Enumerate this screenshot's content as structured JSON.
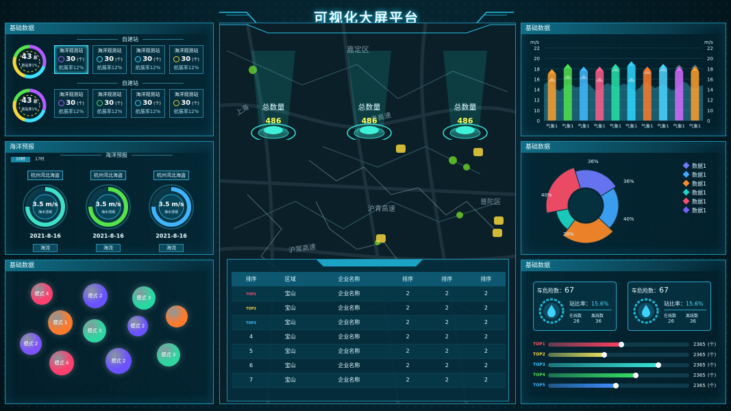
{
  "title": "可视化大屏平台",
  "left_top": {
    "head": "基础数据",
    "groups": [
      {
        "sub_title": "自建站",
        "ring_value": "43",
        "ring_unit": "总",
        "ring_caption": "航站率1%",
        "stations": [
          {
            "name": "海洋观测站",
            "count": "30",
            "unit": "(个)",
            "rate": "航展率12%",
            "color": "#b55bff",
            "active": true
          },
          {
            "name": "海洋观测站",
            "count": "30",
            "unit": "(个)",
            "rate": "航展率12%",
            "color": "#4fe0ff",
            "active": false
          },
          {
            "name": "海洋观测站",
            "count": "30",
            "unit": "(个)",
            "rate": "航展率12%",
            "color": "#3ad6ff",
            "active": false
          },
          {
            "name": "海洋观测站",
            "count": "30",
            "unit": "(个)",
            "rate": "航展率12%",
            "color": "#f4d63a",
            "active": false
          }
        ]
      },
      {
        "sub_title": "自建站",
        "ring_value": "43",
        "ring_unit": "总",
        "ring_caption": "航站率1%",
        "stations": [
          {
            "name": "海洋观测站",
            "count": "30",
            "unit": "(个)",
            "rate": "航展率12%",
            "color": "#b55bff",
            "active": false
          },
          {
            "name": "海洋观测站",
            "count": "30",
            "unit": "(个)",
            "rate": "航展率12%",
            "color": "#4fe07a",
            "active": false
          },
          {
            "name": "海洋观测站",
            "count": "30",
            "unit": "(个)",
            "rate": "航展率12%",
            "color": "#3ad6ff",
            "active": false
          },
          {
            "name": "海洋观测站",
            "count": "30",
            "unit": "(个)",
            "rate": "航展率12%",
            "color": "#f4d63a",
            "active": false
          }
        ]
      }
    ]
  },
  "left_mid": {
    "head": "海洋预报",
    "sub_title": "海洋预报",
    "tabs": [
      "10时",
      "17时"
    ],
    "gauges": [
      {
        "place": "杭州湾北海盗",
        "value": "3.5",
        "unit": "m/s",
        "caption": "海水流域",
        "date": "2021-8-16",
        "footer": "海流",
        "color": "#3ee0c8",
        "level": 0.75
      },
      {
        "place": "杭州湾北海盗",
        "value": "3.5",
        "unit": "m/s",
        "caption": "海水流域",
        "date": "2021-8-16",
        "footer": "海流",
        "color": "#55e34a",
        "level": 0.75
      },
      {
        "place": "杭州湾北海盗",
        "value": "3.5",
        "unit": "m/s",
        "caption": "海水流域",
        "date": "2021-8-16",
        "footer": "海流",
        "color": "#3fb4ff",
        "level": 0.75
      }
    ]
  },
  "left_bottom": {
    "head": "基础数据",
    "bubbles": [
      {
        "label": "模式 4",
        "color": "#ff3f6e"
      },
      {
        "label": "模式 2",
        "color": "#6a52ff"
      },
      {
        "label": "模式 3",
        "color": "#26d9a2"
      },
      {
        "label": "模式 1",
        "color": "#ff7a2a"
      },
      {
        "label": "模式 3",
        "color": "#2fd6a0"
      },
      {
        "label": "模式 2",
        "color": "#6a52ff"
      },
      {
        "label": "",
        "color": "#ff7a2a"
      },
      {
        "label": "模式 2",
        "color": "#7d53ff"
      },
      {
        "label": "模式 4",
        "color": "#ff3f6e"
      },
      {
        "label": "模式 2",
        "color": "#6a52ff"
      },
      {
        "label": "模式 3",
        "color": "#2fd6a0"
      }
    ]
  },
  "map": {
    "labels": [
      "嘉定区",
      "上海",
      "沪青高速",
      "沪常高速",
      "普陀区",
      "宝山"
    ],
    "spots": [
      {
        "label": "总数量",
        "value": "486"
      },
      {
        "label": "总数量",
        "value": "486"
      },
      {
        "label": "总数量",
        "value": "486"
      }
    ]
  },
  "table": {
    "headers": [
      "排序",
      "区域",
      "企业名称",
      "排序",
      "排序",
      "排序"
    ],
    "rows": [
      {
        "rank": "TOP1",
        "region": "宝山",
        "company": "企业名称",
        "a": "2",
        "b": "2",
        "c": "2",
        "color": "#ff4f6d"
      },
      {
        "rank": "TOP2",
        "region": "宝山",
        "company": "企业名称",
        "a": "2",
        "b": "2",
        "c": "2",
        "color": "#f7d34a"
      },
      {
        "rank": "TOP3",
        "region": "宝山",
        "company": "企业名称",
        "a": "2",
        "b": "2",
        "c": "2",
        "color": "#38c3ff"
      },
      {
        "rank": "4",
        "region": "宝山",
        "company": "企业名称",
        "a": "2",
        "b": "2",
        "c": "2",
        "color": ""
      },
      {
        "rank": "5",
        "region": "宝山",
        "company": "企业名称",
        "a": "2",
        "b": "2",
        "c": "2",
        "color": ""
      },
      {
        "rank": "6",
        "region": "宝山",
        "company": "企业名称",
        "a": "2",
        "b": "2",
        "c": "2",
        "color": ""
      },
      {
        "rank": "7",
        "region": "宝山",
        "company": "企业名称",
        "a": "2",
        "b": "2",
        "c": "2",
        "color": ""
      }
    ]
  },
  "right_top": {
    "head": "基础数据",
    "chart_data": {
      "type": "bar",
      "categories": [
        "气象1",
        "气象1",
        "气象1",
        "气象1",
        "气象1",
        "气象1",
        "气象1",
        "气象1",
        "气象1",
        "气象1"
      ],
      "values": [
        17,
        18,
        17.5,
        17.5,
        18,
        18.5,
        17.5,
        18,
        17.5,
        17.5
      ],
      "secondary": [
        15.5,
        16,
        16,
        15.5,
        17.5,
        15.5,
        17,
        17.5,
        18,
        18
      ],
      "bar_colors": [
        "#ff9f2c",
        "#52e04e",
        "#43b8ff",
        "#ff5c8a",
        "#27e0a9",
        "#2fd6ff",
        "#ff7a2a",
        "#4bd2ff",
        "#d46bff",
        "#ff9f2c"
      ],
      "yunit_left": "m/s",
      "yunit_right": "m/s",
      "ylim": [
        0,
        22
      ],
      "yticks": [
        0,
        2,
        6,
        10,
        14,
        16,
        18,
        20,
        22
      ]
    }
  },
  "right_mid": {
    "head": "基础数据",
    "chart_data": {
      "type": "pie",
      "labels": [
        "36%",
        "36%",
        "40%",
        "20%",
        "40%"
      ],
      "values": [
        36,
        36,
        40,
        20,
        40
      ],
      "colors": [
        "#6e7bff",
        "#3fa8ff",
        "#ff8a2a",
        "#1bd6c7",
        "#ff4e6a"
      ]
    },
    "legend": [
      {
        "label": "数据1",
        "color": "#6e7bff"
      },
      {
        "label": "数据1",
        "color": "#3fa8ff"
      },
      {
        "label": "数据1",
        "color": "#ff8a2a"
      },
      {
        "label": "数据1",
        "color": "#1bd6c7"
      },
      {
        "label": "数据1",
        "color": "#ff4e6a"
      },
      {
        "label": "数据1",
        "color": "#7a5bff"
      }
    ]
  },
  "right_bottom": {
    "head": "基础数据",
    "cards": [
      {
        "title": "车危险数：",
        "value": "67",
        "rate_label": "站比率：",
        "rate": "15.6%",
        "online_label": "在线数",
        "online": "26",
        "offline_label": "离线数",
        "offline": "36"
      },
      {
        "title": "车危险数：",
        "value": "67",
        "rate_label": "站比率：",
        "rate": "15.6%",
        "online_label": "在线数",
        "online": "26",
        "offline_label": "离线数",
        "offline": "36"
      }
    ],
    "bars": [
      {
        "label": "TOP1",
        "value": "2365",
        "unit": "(个)",
        "level": 0.52,
        "color": "#ff3f5e",
        "label_color": "#ff5a5a"
      },
      {
        "label": "TOP2",
        "value": "2365",
        "unit": "(个)",
        "level": 0.4,
        "color": "#e8e05a",
        "label_color": "#f1d24a"
      },
      {
        "label": "TOP3",
        "value": "2365",
        "unit": "(个)",
        "level": 0.78,
        "color": "#38e4d7",
        "label_color": "#38c3ff"
      },
      {
        "label": "TOP4",
        "value": "2365",
        "unit": "(个)",
        "level": 0.62,
        "color": "#36df63",
        "label_color": "#4fe04a"
      },
      {
        "label": "TOP5",
        "value": "2365",
        "unit": "(个)",
        "level": 0.48,
        "color": "#3f8dff",
        "label_color": "#3fb4ff"
      }
    ]
  }
}
